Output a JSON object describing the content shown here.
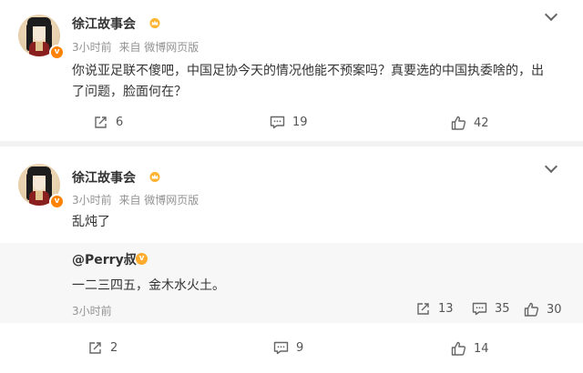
{
  "comments": [
    {
      "username": "徐江故事会",
      "vbadge": "v",
      "time": "3小时前",
      "source": "来自 微博网页版",
      "content": "你说亚足联不傻吧，中国足协今天的情况他能不预案吗？真要选的中国执委啥的，出了问题，脸面何在？",
      "actions": {
        "share": "6",
        "comment": "19",
        "like": "42"
      }
    },
    {
      "username": "徐江故事会",
      "vbadge": "v",
      "time": "3小时前",
      "source": "来自 微博网页版",
      "content": "乱炖了",
      "quote": {
        "username": "@Perry叔",
        "badge": "v",
        "text": "一二三四五，金木水火土。",
        "time": "3小时前",
        "actions": {
          "share": "13",
          "comment": "35",
          "like": "30"
        }
      },
      "actions": {
        "share": "2",
        "comment": "9",
        "like": "14"
      }
    }
  ],
  "icons": {
    "share": "share-icon",
    "comment": "comment-icon",
    "like": "thumbs-up-icon",
    "more": "chevron-down-icon",
    "crown": "crown-icon"
  },
  "colors": {
    "verified": "#ff8200",
    "meta": "#939393",
    "background": "#f2f2f2"
  }
}
